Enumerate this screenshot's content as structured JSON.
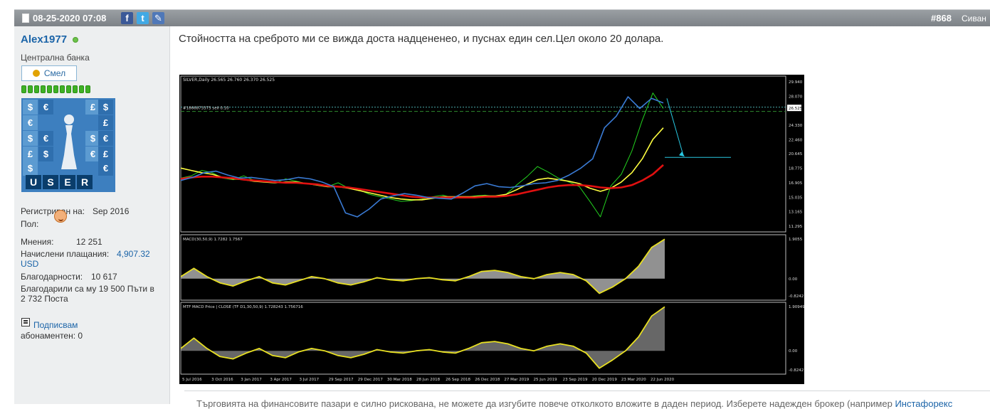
{
  "post": {
    "date": "08-25-2020 07:08",
    "number": "#868",
    "header_right": "Сиван",
    "share": {
      "facebook": "f",
      "twitter": "t",
      "link": "✎"
    }
  },
  "user": {
    "name": "Alex1977",
    "title": "Централна банка",
    "rank_label": "Смел",
    "reputation_bars": 11,
    "avatar": {
      "symbols": [
        "$",
        "€",
        "£",
        "$",
        "€",
        "£",
        "$",
        "€"
      ],
      "letters": [
        "U",
        "S",
        "E",
        "R"
      ]
    },
    "registered_label": "Регистриран на:",
    "registered_value": "Sep 2016",
    "gender_label": "Пол:",
    "posts_label": "Мнения:",
    "posts_value": "12 251",
    "payments_label": "Начислени плащания:",
    "payments_value": "4,907.32",
    "payments_unit": "USD",
    "thanks_label": "Благодарности:",
    "thanks_value": "10 617",
    "thanked_line1": "Благодарили са му 19 500 Пъти в",
    "thanked_line2": "2 732 Поста",
    "subscribe_label": "Подписвам",
    "subscribed_line": "абонаментен: 0"
  },
  "content": {
    "message": "Стойността на среброто ми се вижда доста надцененео, и пуснах един сел.Цел около 20 долара.",
    "signature_text": "Търговията на финансовите пазари е силно рискована, не можете да изгубите повече отколкото вложите в даден период. Изберете надежден брокер (например ",
    "signature_link": "Инстафорекс"
  },
  "chart_data": [
    {
      "type": "line",
      "title": "SILVER,Daily  26.565 26.760 26.370 26.525",
      "order_label": "#1866873375 sell 0.10",
      "current_price_label": "26.525",
      "y_ticks": [
        "29.940",
        "28.070",
        "26.525",
        "24.330",
        "22.460",
        "20.645",
        "18.775",
        "16.905",
        "15.035",
        "13.165",
        "11.295"
      ],
      "x_ticks": [
        "5 Jul 2016",
        "3 Oct 2016",
        "3 Jan 2017",
        "3 Apr 2017",
        "3 Jul 2017",
        "29 Sep 2017",
        "29 Dec 2017",
        "30 Mar 2018",
        "28 Jun 2018",
        "26 Sep 2018",
        "26 Dec 2018",
        "27 Mar 2019",
        "25 Jun 2019",
        "23 Sep 2019",
        "20 Dec 2019",
        "23 Mar 2020",
        "22 Jun 2020"
      ],
      "ylim": [
        11.295,
        29.94
      ],
      "series": [
        {
          "name": "price",
          "color": "#23d11f",
          "values": [
            17.5,
            17.8,
            18.5,
            18.2,
            17.5,
            17.3,
            17.8,
            17.2,
            17.0,
            16.9,
            17.4,
            17.1,
            16.8,
            16.6,
            16.4,
            16.9,
            16.2,
            16.0,
            15.4,
            15.1,
            14.8,
            14.5,
            14.6,
            14.8,
            15.1,
            15.3,
            14.9,
            15.0,
            15.2,
            15.3,
            15.1,
            15.4,
            16.6,
            17.7,
            19.0,
            18.3,
            17.5,
            17.0,
            16.4,
            14.5,
            12.5,
            16.5,
            18.0,
            21.0,
            25.0,
            28.5,
            26.5
          ]
        },
        {
          "name": "fast-ma",
          "color": "#ffff40",
          "values": [
            18.8,
            18.5,
            18.2,
            18.0,
            17.6,
            17.4,
            17.3,
            17.1,
            17.0,
            16.9,
            17.0,
            17.0,
            16.8,
            16.6,
            16.4,
            16.4,
            16.2,
            15.9,
            15.6,
            15.3,
            15.0,
            14.8,
            14.7,
            14.7,
            14.9,
            15.1,
            15.1,
            15.1,
            15.1,
            15.2,
            15.2,
            15.4,
            16.0,
            16.7,
            17.3,
            17.5,
            17.3,
            17.1,
            16.8,
            16.2,
            15.8,
            16.2,
            17.0,
            18.2,
            20.0,
            22.5,
            24.0
          ]
        },
        {
          "name": "slow-ma",
          "color": "#e01010",
          "values": [
            17.4,
            17.6,
            17.7,
            17.7,
            17.6,
            17.5,
            17.3,
            17.2,
            17.1,
            17.0,
            16.9,
            16.9,
            16.8,
            16.7,
            16.5,
            16.4,
            16.3,
            16.1,
            15.9,
            15.7,
            15.5,
            15.3,
            15.1,
            15.0,
            15.0,
            15.0,
            15.0,
            15.0,
            15.0,
            15.1,
            15.1,
            15.2,
            15.4,
            15.7,
            16.0,
            16.3,
            16.5,
            16.6,
            16.6,
            16.5,
            16.3,
            16.2,
            16.3,
            16.6,
            17.2,
            18.0,
            19.2
          ]
        },
        {
          "name": "trend-ma",
          "color": "#3a7bd5",
          "values": [
            17.2,
            17.6,
            18.2,
            18.4,
            17.9,
            17.5,
            17.6,
            17.4,
            17.2,
            17.3,
            17.6,
            17.4,
            17.0,
            16.4,
            13.0,
            12.5,
            13.5,
            14.8,
            15.2,
            15.5,
            15.3,
            15.0,
            14.9,
            14.8,
            15.6,
            16.5,
            16.8,
            16.4,
            16.3,
            16.5,
            16.8,
            16.9,
            17.2,
            17.9,
            18.8,
            20.0,
            24.0,
            25.5,
            28.0,
            26.5,
            27.8,
            27.2
          ]
        }
      ],
      "annotation": {
        "target_level": 20.0,
        "arrow_color": "#28c6e0"
      }
    },
    {
      "type": "area",
      "title": "MACD(30,50,9) 1.7282 1.7567",
      "y_ticks": [
        "1.9055",
        "0.00",
        "-0.8242"
      ],
      "ylim": [
        -0.8242,
        1.9055
      ],
      "series": [
        {
          "name": "MACD",
          "color": "#aaaaaa",
          "values": [
            0.1,
            0.5,
            0.1,
            -0.2,
            -0.35,
            -0.1,
            0.1,
            -0.2,
            -0.3,
            -0.1,
            0.1,
            0.0,
            -0.2,
            -0.3,
            -0.15,
            0.05,
            -0.05,
            -0.1,
            0.0,
            0.05,
            -0.05,
            -0.1,
            0.1,
            0.35,
            0.4,
            0.3,
            0.1,
            0.0,
            0.2,
            0.3,
            0.2,
            -0.1,
            -0.7,
            -0.4,
            0.0,
            0.6,
            1.5,
            1.9
          ]
        }
      ]
    },
    {
      "type": "area",
      "title": "MTF MACD Price | CLOSE  (TF D1,30,50,9) 1.728243 1.756716",
      "y_ticks": [
        "1.909494",
        "0.00",
        "-0.82421"
      ],
      "ylim": [
        -0.82421,
        1.909494
      ],
      "series": [
        {
          "name": "MTF MACD",
          "color": "#bbbbbb",
          "values": [
            0.1,
            0.55,
            0.1,
            -0.25,
            -0.35,
            -0.1,
            0.1,
            -0.2,
            -0.3,
            -0.05,
            0.1,
            0.0,
            -0.2,
            -0.3,
            -0.15,
            0.05,
            -0.05,
            -0.1,
            0.0,
            0.05,
            -0.05,
            -0.1,
            0.1,
            0.35,
            0.4,
            0.3,
            0.1,
            0.0,
            0.2,
            0.3,
            0.2,
            -0.1,
            -0.75,
            -0.4,
            0.0,
            0.6,
            1.5,
            1.9
          ]
        }
      ]
    }
  ]
}
